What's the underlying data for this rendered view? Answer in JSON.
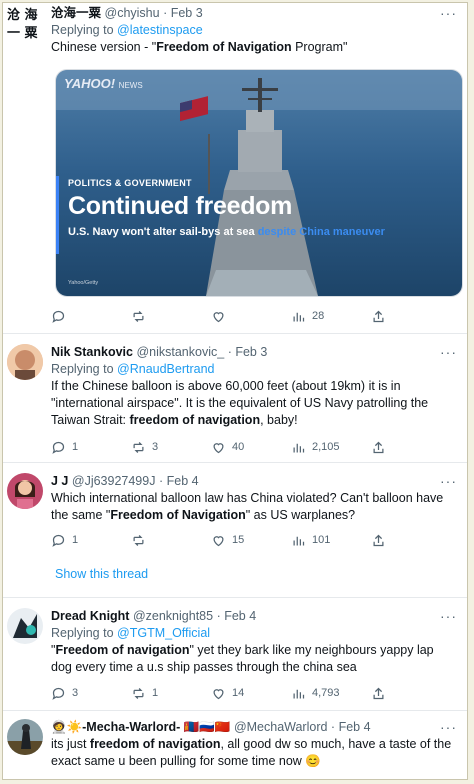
{
  "tweets": [
    {
      "avatar_text": "沧海\n一粟",
      "name": "沧海一粟",
      "handle": "@chyishu",
      "date": "Feb 3",
      "replying_prefix": "Replying to",
      "replying_to": "@latestinspace",
      "text_before": "Chinese version - \"",
      "text_bold": "Freedom of Navigation",
      "text_after": " Program\"",
      "media": {
        "logo": "YAHOO!",
        "logo_sub": "NEWS",
        "category": "POLITICS & GOVERNMENT",
        "headline": "Continued freedom",
        "sub_before": "U.S. Navy won't alter sail-bys at sea ",
        "sub_highlight": "despite China maneuver",
        "credit": "Yahoo/Getty"
      },
      "stats": {
        "replies": "",
        "retweets": "",
        "likes": "",
        "views": "28"
      }
    },
    {
      "name": "Nik Stankovic",
      "handle": "@nikstankovic_",
      "date": "Feb 3",
      "replying_prefix": "Replying to",
      "replying_to": "@RnaudBertrand",
      "text_before": "If the Chinese balloon is above 60,000 feet (about 19km) it is in \"international airspace\". It is the equivalent of US Navy patrolling the Taiwan Strait: ",
      "text_bold": "freedom of navigation",
      "text_after": ", baby!",
      "stats": {
        "replies": "1",
        "retweets": "3",
        "likes": "40",
        "views": "2,105"
      }
    },
    {
      "name": "J J",
      "handle": "@Jj63927499J",
      "date": "Feb 4",
      "text_before": "Which international balloon law has China violated? Can't balloon have the same \"",
      "text_bold": "Freedom of Navigation",
      "text_after": "\" as US warplanes?",
      "stats": {
        "replies": "1",
        "retweets": "",
        "likes": "15",
        "views": "101"
      },
      "show_thread": "Show this thread"
    },
    {
      "name": "Dread Knight",
      "handle": "@zenknight85",
      "date": "Feb 4",
      "replying_prefix": "Replying to",
      "replying_to": "@TGTM_Official",
      "text_before": "\"",
      "text_bold": "Freedom of navigation",
      "text_after": "\" yet they bark like my neighbours yappy lap dog every time a u.s ship passes through the china sea",
      "stats": {
        "replies": "3",
        "retweets": "1",
        "likes": "14",
        "views": "4,793"
      }
    },
    {
      "name": "🧑‍🚀☀️-Mecha-Warlord- 🇲🇳🇷🇺🇨🇳",
      "handle": "@MechaWarlord",
      "date": "Feb 4",
      "text_before": "its just ",
      "text_bold": "freedom of navigation",
      "text_after": ", all good dw so much, have a taste of the exact same u been pulling for some time now 😊"
    }
  ],
  "ui": {
    "more": "···",
    "separator": "·"
  },
  "colors": {
    "link": "#1d9bf0",
    "muted": "#536471"
  }
}
